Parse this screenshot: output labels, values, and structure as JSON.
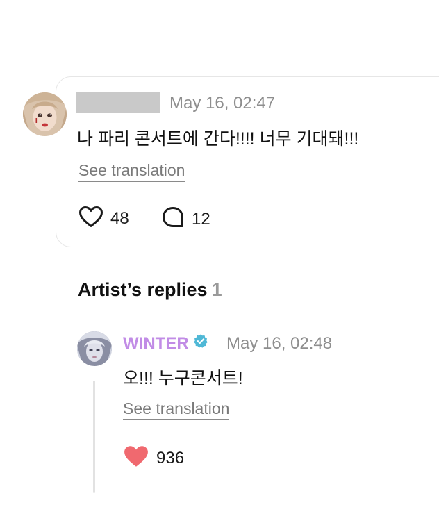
{
  "post": {
    "timestamp": "May 16, 02:47",
    "text": "나 파리 콘서트에 간다!!!! 너무 기대돼!!!",
    "see_translation": "See translation",
    "likes": "48",
    "comments": "12",
    "icons": [
      "heart-outline-icon",
      "speech-bubble-icon"
    ]
  },
  "replies": {
    "title": "Artist’s replies",
    "count": "1",
    "items": [
      {
        "author": "WINTER",
        "verified": true,
        "timestamp": "May 16, 02:48",
        "text": "오!!! 누구콘서트!",
        "see_translation": "See translation",
        "likes": "936",
        "liked": true
      }
    ]
  },
  "colors": {
    "artist_name": "#c18ce6",
    "verified_badge": "#4fb8d6",
    "liked_heart": "#f0696f",
    "muted_text": "#8e8e8e",
    "card_border": "#e6e6e6"
  }
}
